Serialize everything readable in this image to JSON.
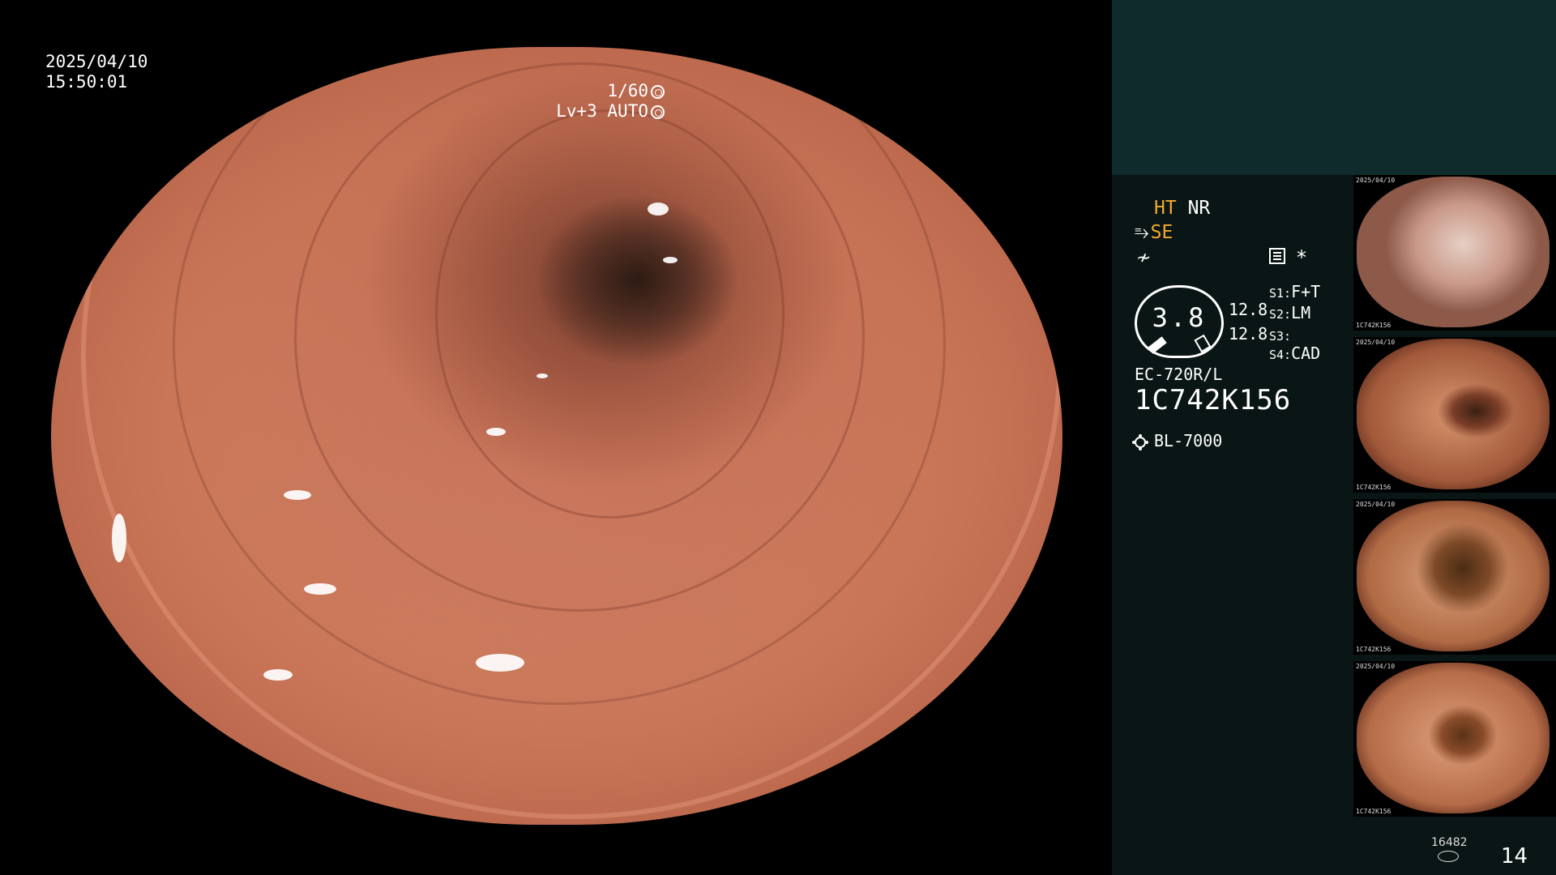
{
  "overlay": {
    "date": "2025/04/10",
    "time": "15:50:01",
    "shutter": "1/60",
    "exposure": "Lv+3 AUTO"
  },
  "panel": {
    "ht": "HT",
    "nr": "NR",
    "se": "SE",
    "fx": "≁",
    "gauge_value": "3.8",
    "gauge_val_1": "12.8",
    "gauge_val_2": "12.8",
    "settings": [
      {
        "key": "S1:",
        "value": "F+T"
      },
      {
        "key": "S2:",
        "value": "LM"
      },
      {
        "key": "S3:",
        "value": ""
      },
      {
        "key": "S4:",
        "value": "CAD"
      }
    ],
    "scope_model": "EC-720R/L",
    "scope_serial": "1C742K156",
    "light_source": "BL-7000",
    "star": "*"
  },
  "thumbnails": [
    {
      "date": "2025/04/10",
      "serial": "1C742K156"
    },
    {
      "date": "2025/04/10",
      "serial": "1C742K156"
    },
    {
      "date": "2025/04/10",
      "serial": "1C742K156"
    },
    {
      "date": "2025/04/10",
      "serial": "1C742K156"
    }
  ],
  "footer": {
    "count_small": "16482",
    "count_big": "14"
  },
  "colors": {
    "accent_orange": "#f0a830",
    "panel_bg": "#0a1515",
    "panel_top": "#0f2b2b"
  }
}
